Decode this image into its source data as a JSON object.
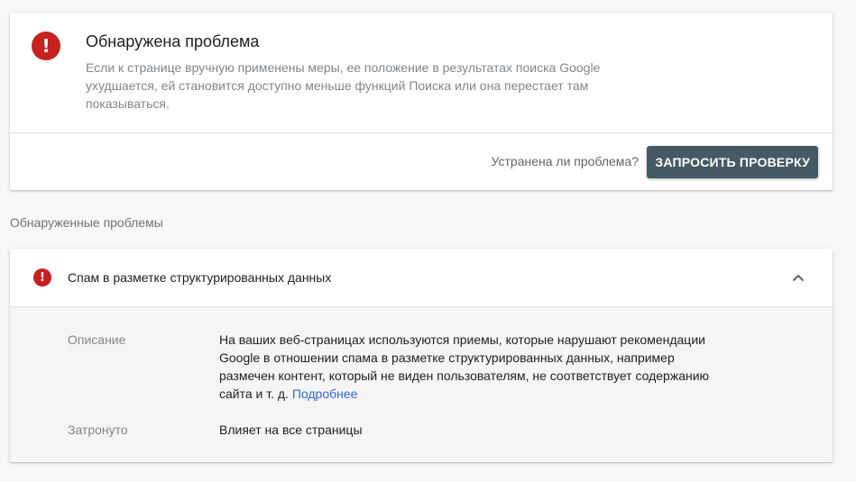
{
  "alert": {
    "title": "Обнаружена проблема",
    "description": "Если к странице вручную применены меры, ее положение в результатах поиска Google ухудшается, ей становится доступно меньше функций Поиска или она перестает там показываться.",
    "fixed_question": "Устранена ли проблема?",
    "request_review_label": "ЗАПРОСИТЬ ПРОВЕРКУ",
    "icon": "error-icon",
    "icon_glyph": "!",
    "icon_color": "#c5221f",
    "button_color": "#455a64"
  },
  "issues_section": {
    "heading": "Обнаруженные проблемы"
  },
  "issue": {
    "title": "Спам в разметке структурированных данных",
    "icon": "error-icon",
    "icon_glyph": "!",
    "expanded": true,
    "description_label": "Описание",
    "description_text": "На ваших веб-страницах используются приемы, которые нарушают рекомендации Google в отношении спама в разметке структурированных данных, например размечен контент, который не виден пользователям, не соответствует содержанию сайта и т. д.",
    "learn_more_label": "Подробнее",
    "link_color": "#3367d6",
    "affected_label": "Затронуто",
    "affected_value": "Влияет на все страницы"
  }
}
